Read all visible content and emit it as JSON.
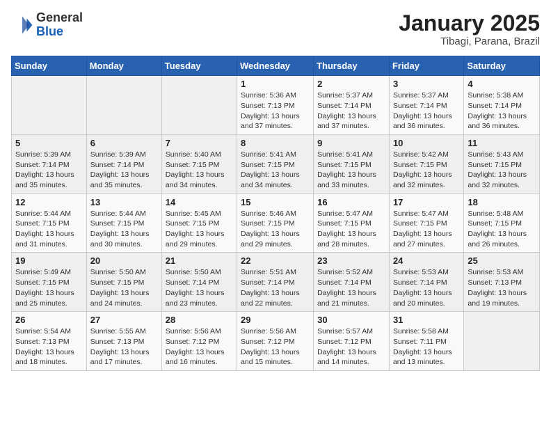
{
  "header": {
    "logo_general": "General",
    "logo_blue": "Blue",
    "main_title": "January 2025",
    "subtitle": "Tibagi, Parana, Brazil"
  },
  "weekdays": [
    "Sunday",
    "Monday",
    "Tuesday",
    "Wednesday",
    "Thursday",
    "Friday",
    "Saturday"
  ],
  "weeks": [
    [
      {
        "day": "",
        "info": ""
      },
      {
        "day": "",
        "info": ""
      },
      {
        "day": "",
        "info": ""
      },
      {
        "day": "1",
        "info": "Sunrise: 5:36 AM\nSunset: 7:13 PM\nDaylight: 13 hours\nand 37 minutes."
      },
      {
        "day": "2",
        "info": "Sunrise: 5:37 AM\nSunset: 7:14 PM\nDaylight: 13 hours\nand 37 minutes."
      },
      {
        "day": "3",
        "info": "Sunrise: 5:37 AM\nSunset: 7:14 PM\nDaylight: 13 hours\nand 36 minutes."
      },
      {
        "day": "4",
        "info": "Sunrise: 5:38 AM\nSunset: 7:14 PM\nDaylight: 13 hours\nand 36 minutes."
      }
    ],
    [
      {
        "day": "5",
        "info": "Sunrise: 5:39 AM\nSunset: 7:14 PM\nDaylight: 13 hours\nand 35 minutes."
      },
      {
        "day": "6",
        "info": "Sunrise: 5:39 AM\nSunset: 7:14 PM\nDaylight: 13 hours\nand 35 minutes."
      },
      {
        "day": "7",
        "info": "Sunrise: 5:40 AM\nSunset: 7:15 PM\nDaylight: 13 hours\nand 34 minutes."
      },
      {
        "day": "8",
        "info": "Sunrise: 5:41 AM\nSunset: 7:15 PM\nDaylight: 13 hours\nand 34 minutes."
      },
      {
        "day": "9",
        "info": "Sunrise: 5:41 AM\nSunset: 7:15 PM\nDaylight: 13 hours\nand 33 minutes."
      },
      {
        "day": "10",
        "info": "Sunrise: 5:42 AM\nSunset: 7:15 PM\nDaylight: 13 hours\nand 32 minutes."
      },
      {
        "day": "11",
        "info": "Sunrise: 5:43 AM\nSunset: 7:15 PM\nDaylight: 13 hours\nand 32 minutes."
      }
    ],
    [
      {
        "day": "12",
        "info": "Sunrise: 5:44 AM\nSunset: 7:15 PM\nDaylight: 13 hours\nand 31 minutes."
      },
      {
        "day": "13",
        "info": "Sunrise: 5:44 AM\nSunset: 7:15 PM\nDaylight: 13 hours\nand 30 minutes."
      },
      {
        "day": "14",
        "info": "Sunrise: 5:45 AM\nSunset: 7:15 PM\nDaylight: 13 hours\nand 29 minutes."
      },
      {
        "day": "15",
        "info": "Sunrise: 5:46 AM\nSunset: 7:15 PM\nDaylight: 13 hours\nand 29 minutes."
      },
      {
        "day": "16",
        "info": "Sunrise: 5:47 AM\nSunset: 7:15 PM\nDaylight: 13 hours\nand 28 minutes."
      },
      {
        "day": "17",
        "info": "Sunrise: 5:47 AM\nSunset: 7:15 PM\nDaylight: 13 hours\nand 27 minutes."
      },
      {
        "day": "18",
        "info": "Sunrise: 5:48 AM\nSunset: 7:15 PM\nDaylight: 13 hours\nand 26 minutes."
      }
    ],
    [
      {
        "day": "19",
        "info": "Sunrise: 5:49 AM\nSunset: 7:15 PM\nDaylight: 13 hours\nand 25 minutes."
      },
      {
        "day": "20",
        "info": "Sunrise: 5:50 AM\nSunset: 7:15 PM\nDaylight: 13 hours\nand 24 minutes."
      },
      {
        "day": "21",
        "info": "Sunrise: 5:50 AM\nSunset: 7:14 PM\nDaylight: 13 hours\nand 23 minutes."
      },
      {
        "day": "22",
        "info": "Sunrise: 5:51 AM\nSunset: 7:14 PM\nDaylight: 13 hours\nand 22 minutes."
      },
      {
        "day": "23",
        "info": "Sunrise: 5:52 AM\nSunset: 7:14 PM\nDaylight: 13 hours\nand 21 minutes."
      },
      {
        "day": "24",
        "info": "Sunrise: 5:53 AM\nSunset: 7:14 PM\nDaylight: 13 hours\nand 20 minutes."
      },
      {
        "day": "25",
        "info": "Sunrise: 5:53 AM\nSunset: 7:13 PM\nDaylight: 13 hours\nand 19 minutes."
      }
    ],
    [
      {
        "day": "26",
        "info": "Sunrise: 5:54 AM\nSunset: 7:13 PM\nDaylight: 13 hours\nand 18 minutes."
      },
      {
        "day": "27",
        "info": "Sunrise: 5:55 AM\nSunset: 7:13 PM\nDaylight: 13 hours\nand 17 minutes."
      },
      {
        "day": "28",
        "info": "Sunrise: 5:56 AM\nSunset: 7:12 PM\nDaylight: 13 hours\nand 16 minutes."
      },
      {
        "day": "29",
        "info": "Sunrise: 5:56 AM\nSunset: 7:12 PM\nDaylight: 13 hours\nand 15 minutes."
      },
      {
        "day": "30",
        "info": "Sunrise: 5:57 AM\nSunset: 7:12 PM\nDaylight: 13 hours\nand 14 minutes."
      },
      {
        "day": "31",
        "info": "Sunrise: 5:58 AM\nSunset: 7:11 PM\nDaylight: 13 hours\nand 13 minutes."
      },
      {
        "day": "",
        "info": ""
      }
    ]
  ]
}
